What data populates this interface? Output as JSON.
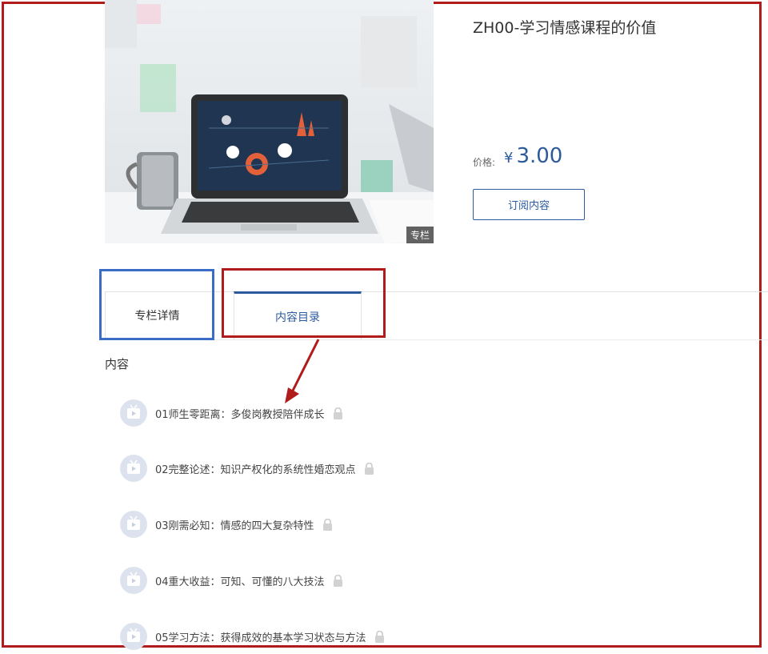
{
  "course": {
    "title": "ZH00-学习情感课程的价值",
    "badge": "专栏",
    "price_label": "价格:",
    "currency": "¥",
    "price": "3.00",
    "subscribe_label": "订阅内容"
  },
  "tabs": [
    {
      "label": "专栏详情",
      "active": false
    },
    {
      "label": "内容目录",
      "active": true
    }
  ],
  "content": {
    "heading": "内容",
    "lessons": [
      {
        "title": "01师生零距离：多俊岗教授陪伴成长",
        "locked": true,
        "icon": "video-tv-icon"
      },
      {
        "title": "02完整论述：知识产权化的系统性婚恋观点",
        "locked": true,
        "icon": "video-tv-icon"
      },
      {
        "title": "03刚需必知：情感的四大复杂特性",
        "locked": true,
        "icon": "video-tv-icon"
      },
      {
        "title": "04重大收益：可知、可懂的八大技法",
        "locked": true,
        "icon": "video-tv-icon"
      },
      {
        "title": "05学习方法：获得成效的基本学习状态与方法",
        "locked": true,
        "icon": "video-tv-icon"
      }
    ]
  },
  "colors": {
    "accent": "#2b5b9c",
    "annotation_red": "#b01c1c",
    "annotation_blue": "#3b6cc6"
  }
}
